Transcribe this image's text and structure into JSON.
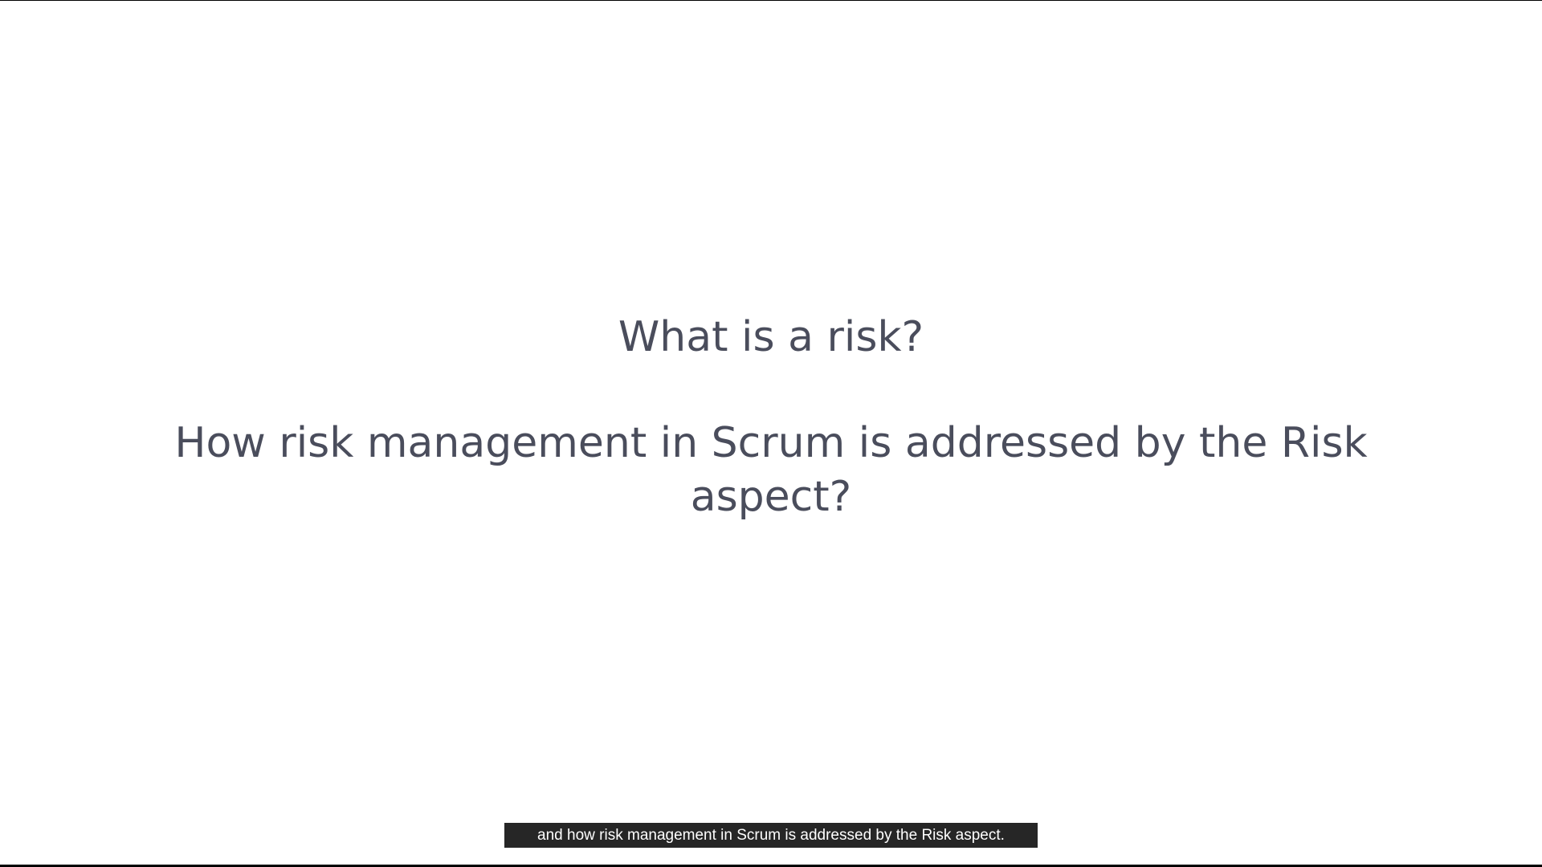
{
  "slide": {
    "question_1": "What is a risk?",
    "question_2": "How risk management in Scrum is addressed by the Risk aspect?"
  },
  "subtitle": {
    "text": "and how risk management in Scrum is addressed by the Risk aspect."
  },
  "colors": {
    "slide_background": "#ffffff",
    "slide_text": "#4a4d5c",
    "caption_background": "#262626",
    "caption_text": "#ffffff",
    "letterbox": "#000000"
  }
}
